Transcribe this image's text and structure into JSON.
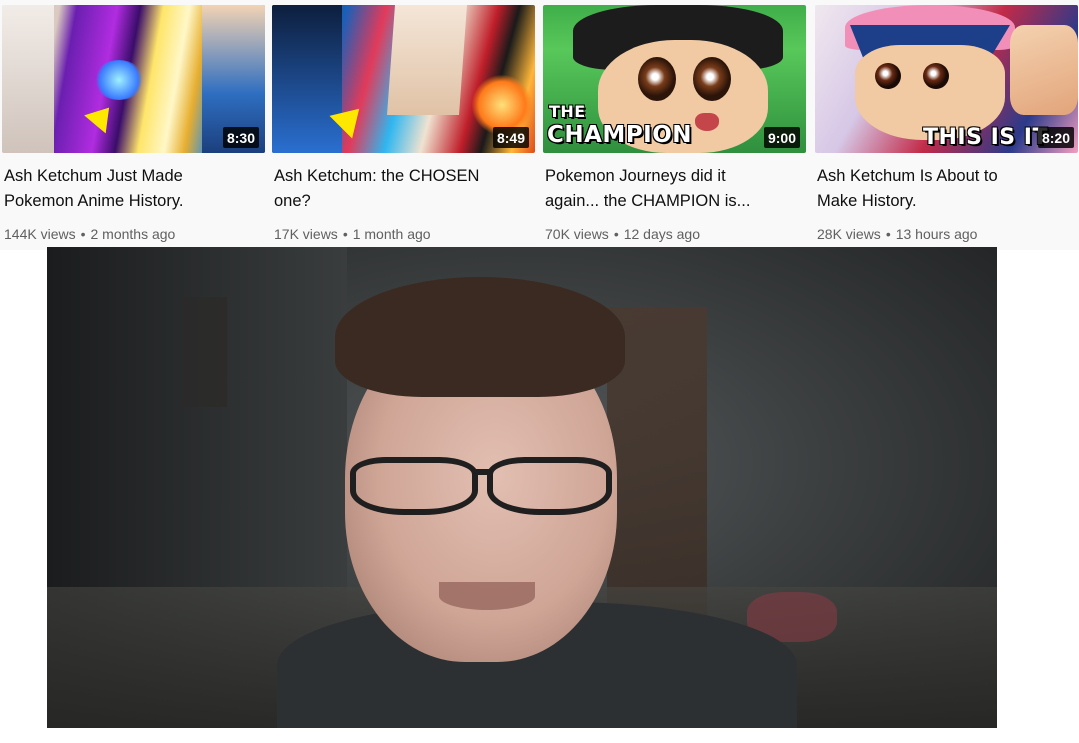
{
  "videos": [
    {
      "title_line1": "Ash Ketchum Just Made",
      "title_line2": "Pokemon Anime History.",
      "views": "144K views",
      "age": "2 months ago",
      "duration": "8:30",
      "overlay": ""
    },
    {
      "title_line1": "Ash Ketchum: the CHOSEN",
      "title_line2": "one?",
      "views": "17K views",
      "age": "1 month ago",
      "duration": "8:49",
      "overlay": ""
    },
    {
      "title_line1": "Pokemon Journeys did it",
      "title_line2": "again... the CHAMPION is...",
      "views": "70K views",
      "age": "12 days ago",
      "duration": "9:00",
      "overlay_small": "THE",
      "overlay": "CHAMPION"
    },
    {
      "title_line1": "Ash Ketchum Is About to",
      "title_line2": "Make History.",
      "views": "28K views",
      "age": "13 hours ago",
      "duration": "8:20",
      "overlay": "THIS IS IT"
    }
  ],
  "separator": "•",
  "colors": {
    "title_text": "#0f0f0f",
    "meta_text": "#606060",
    "grid_background": "#f9f9f9",
    "duration_badge": "#000000"
  }
}
